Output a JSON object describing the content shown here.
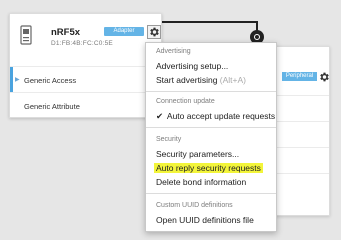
{
  "adapter": {
    "name": "nRF5x",
    "address": "D1:FB:4B:FC:C0:5E",
    "badge": "Adapter",
    "services": [
      {
        "label": "Generic Access"
      },
      {
        "label": "Generic Attribute"
      }
    ]
  },
  "peripheral": {
    "badge": "Peripheral"
  },
  "menu": {
    "sections": {
      "advertising": "Advertising",
      "connection": "Connection update",
      "security": "Security",
      "uuid": "Custom UUID definitions"
    },
    "items": {
      "advertising_setup": "Advertising setup...",
      "start_advertising": "Start advertising",
      "start_advertising_shortcut": "(Alt+A)",
      "auto_accept": "Auto accept update requests",
      "security_params": "Security parameters...",
      "auto_reply": "Auto reply security requests",
      "delete_bond": "Delete bond information",
      "open_uuid": "Open UUID definitions file"
    },
    "highlight_color": "#f3f53a"
  },
  "colors": {
    "badge": "#64b4e6",
    "connector": "#222222",
    "selection_bar": "#4aa3df"
  }
}
